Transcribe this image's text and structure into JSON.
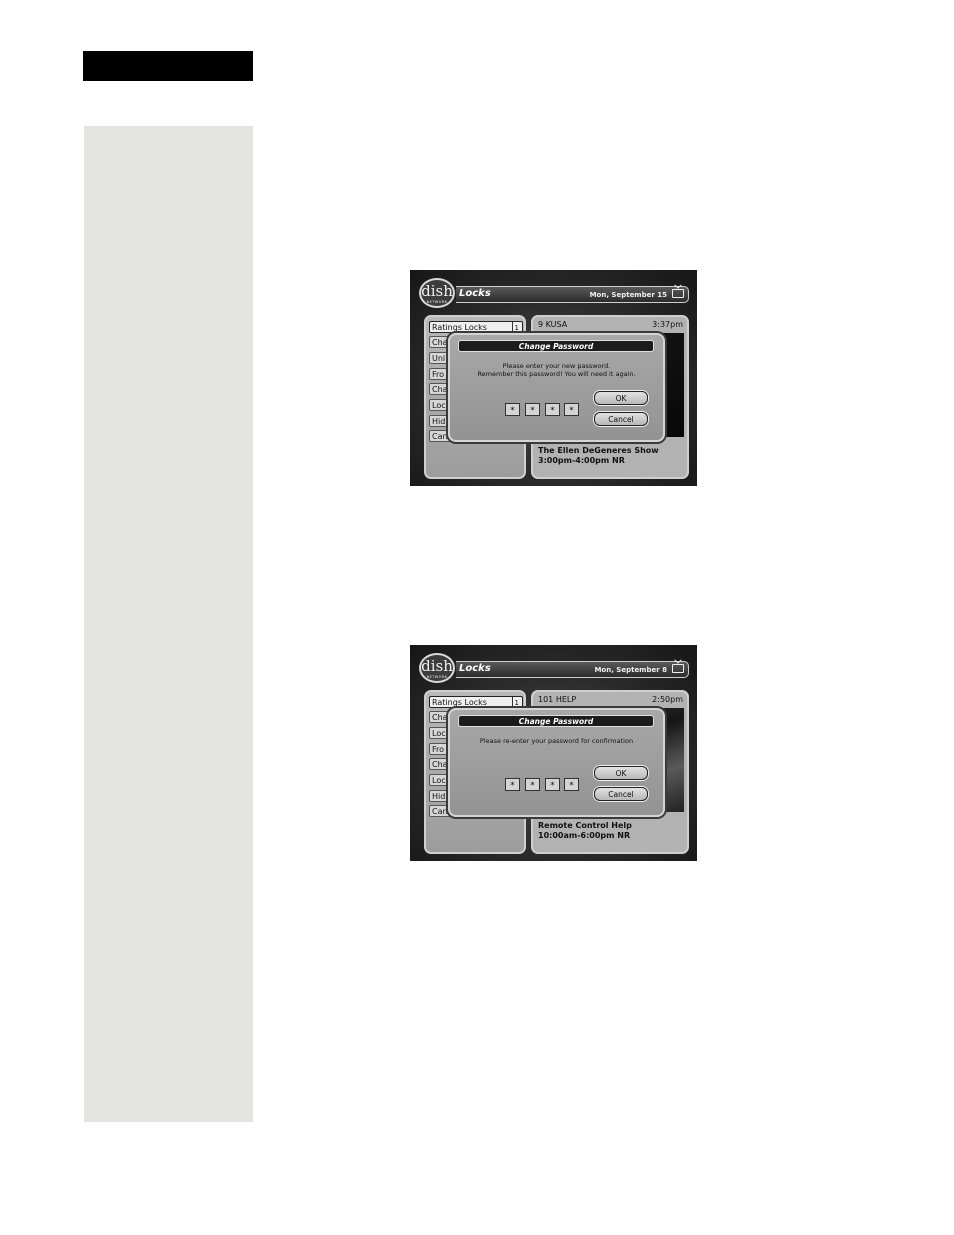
{
  "screens": [
    {
      "logo": "dish",
      "logo_sub": "NETWORK",
      "app_title": "Locks",
      "date": "Mon, September 15",
      "menu": [
        {
          "label": "Ratings Locks",
          "count": "1"
        },
        {
          "label": "Cha"
        },
        {
          "label": "Unl"
        },
        {
          "label": "Fro"
        },
        {
          "label": "Cha"
        },
        {
          "label": "Loc"
        },
        {
          "label": "Hid"
        },
        {
          "label": "Can"
        }
      ],
      "channel": "9 KUSA",
      "time": "3:37pm",
      "show_title": "The Ellen DeGeneres Show",
      "show_time": "3:00pm-4:00pm NR",
      "dialog": {
        "title": "Change Password",
        "message_line1": "Please enter your new password.",
        "message_line2": "Remember this password! You will need it again.",
        "password_chars": [
          "*",
          "*",
          "*",
          "*"
        ],
        "ok_label": "OK",
        "cancel_label": "Cancel"
      }
    },
    {
      "logo": "dish",
      "logo_sub": "NETWORK",
      "app_title": "Locks",
      "date": "Mon, September 8",
      "menu": [
        {
          "label": "Ratings Locks",
          "count": "1"
        },
        {
          "label": "Cha"
        },
        {
          "label": "Loc"
        },
        {
          "label": "Fro"
        },
        {
          "label": "Cha"
        },
        {
          "label": "Loc"
        },
        {
          "label": "Hid"
        },
        {
          "label": "Can"
        }
      ],
      "channel": "101 HELP",
      "time": "2:50pm",
      "show_title": "Remote Control Help",
      "show_time": "10:00am-6:00pm NR",
      "dialog": {
        "title": "Change Password",
        "message_line1": "Please re-enter your password for confirmation",
        "message_line2": "",
        "password_chars": [
          "*",
          "*",
          "*",
          "*"
        ],
        "ok_label": "OK",
        "cancel_label": "Cancel"
      }
    }
  ]
}
